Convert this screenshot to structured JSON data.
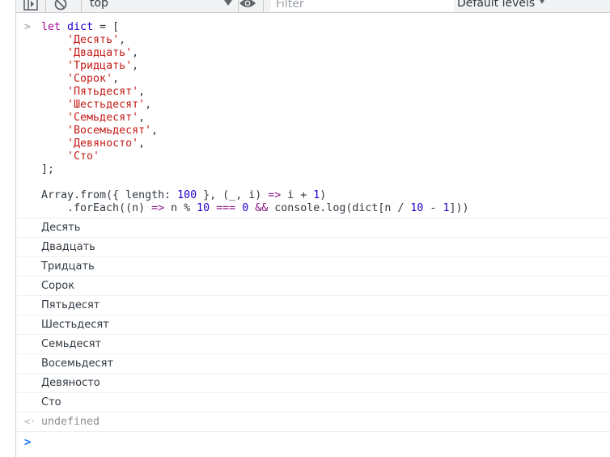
{
  "toolbar": {
    "context": "top",
    "filter_placeholder": "Filter",
    "levels_label": "Default levels"
  },
  "code_tokens": [
    [
      [
        "kw",
        "let"
      ],
      [
        "op",
        " "
      ],
      [
        "var",
        "dict"
      ],
      [
        "op",
        " = ["
      ]
    ],
    [
      [
        "op",
        "    "
      ],
      [
        "str",
        "'Десять'"
      ],
      [
        "op",
        ","
      ]
    ],
    [
      [
        "op",
        "    "
      ],
      [
        "str",
        "'Двадцать'"
      ],
      [
        "op",
        ","
      ]
    ],
    [
      [
        "op",
        "    "
      ],
      [
        "str",
        "'Тридцать'"
      ],
      [
        "op",
        ","
      ]
    ],
    [
      [
        "op",
        "    "
      ],
      [
        "str",
        "'Сорок'"
      ],
      [
        "op",
        ","
      ]
    ],
    [
      [
        "op",
        "    "
      ],
      [
        "str",
        "'Пятьдесят'"
      ],
      [
        "op",
        ","
      ]
    ],
    [
      [
        "op",
        "    "
      ],
      [
        "str",
        "'Шестьдесят'"
      ],
      [
        "op",
        ","
      ]
    ],
    [
      [
        "op",
        "    "
      ],
      [
        "str",
        "'Семьдесят'"
      ],
      [
        "op",
        ","
      ]
    ],
    [
      [
        "op",
        "    "
      ],
      [
        "str",
        "'Восемьдесят'"
      ],
      [
        "op",
        ","
      ]
    ],
    [
      [
        "op",
        "    "
      ],
      [
        "str",
        "'Девяносто'"
      ],
      [
        "op",
        ","
      ]
    ],
    [
      [
        "op",
        "    "
      ],
      [
        "str",
        "'Сто'"
      ]
    ],
    [
      [
        "op",
        "];"
      ]
    ],
    [
      [
        "op",
        ""
      ]
    ],
    [
      [
        "op",
        "Array.from({ length: "
      ],
      [
        "num",
        "100"
      ],
      [
        "op",
        " }, (_, i) "
      ],
      [
        "kw2",
        "=>"
      ],
      [
        "op",
        " i + "
      ],
      [
        "num",
        "1"
      ],
      [
        "op",
        ")"
      ]
    ],
    [
      [
        "op",
        "    .forEach((n) "
      ],
      [
        "kw2",
        "=>"
      ],
      [
        "op",
        " n % "
      ],
      [
        "num",
        "10"
      ],
      [
        "op",
        " "
      ],
      [
        "kw2",
        "==="
      ],
      [
        "op",
        " "
      ],
      [
        "num",
        "0"
      ],
      [
        "op",
        " "
      ],
      [
        "kw2",
        "&&"
      ],
      [
        "op",
        " console.log(dict[n / "
      ],
      [
        "num",
        "10"
      ],
      [
        "op",
        " - "
      ],
      [
        "num",
        "1"
      ],
      [
        "op",
        "]))"
      ]
    ]
  ],
  "log_output": [
    "Десять",
    "Двадцать",
    "Тридцать",
    "Сорок",
    "Пятьдесят",
    "Шестьдесят",
    "Семьдесят",
    "Восемьдесят",
    "Девяносто",
    "Сто"
  ],
  "result": "undefined",
  "icons": {
    "sidebar_toggle": "sidebar-panel-icon",
    "clear": "no-entry-icon",
    "live_expression": "eye-icon"
  }
}
